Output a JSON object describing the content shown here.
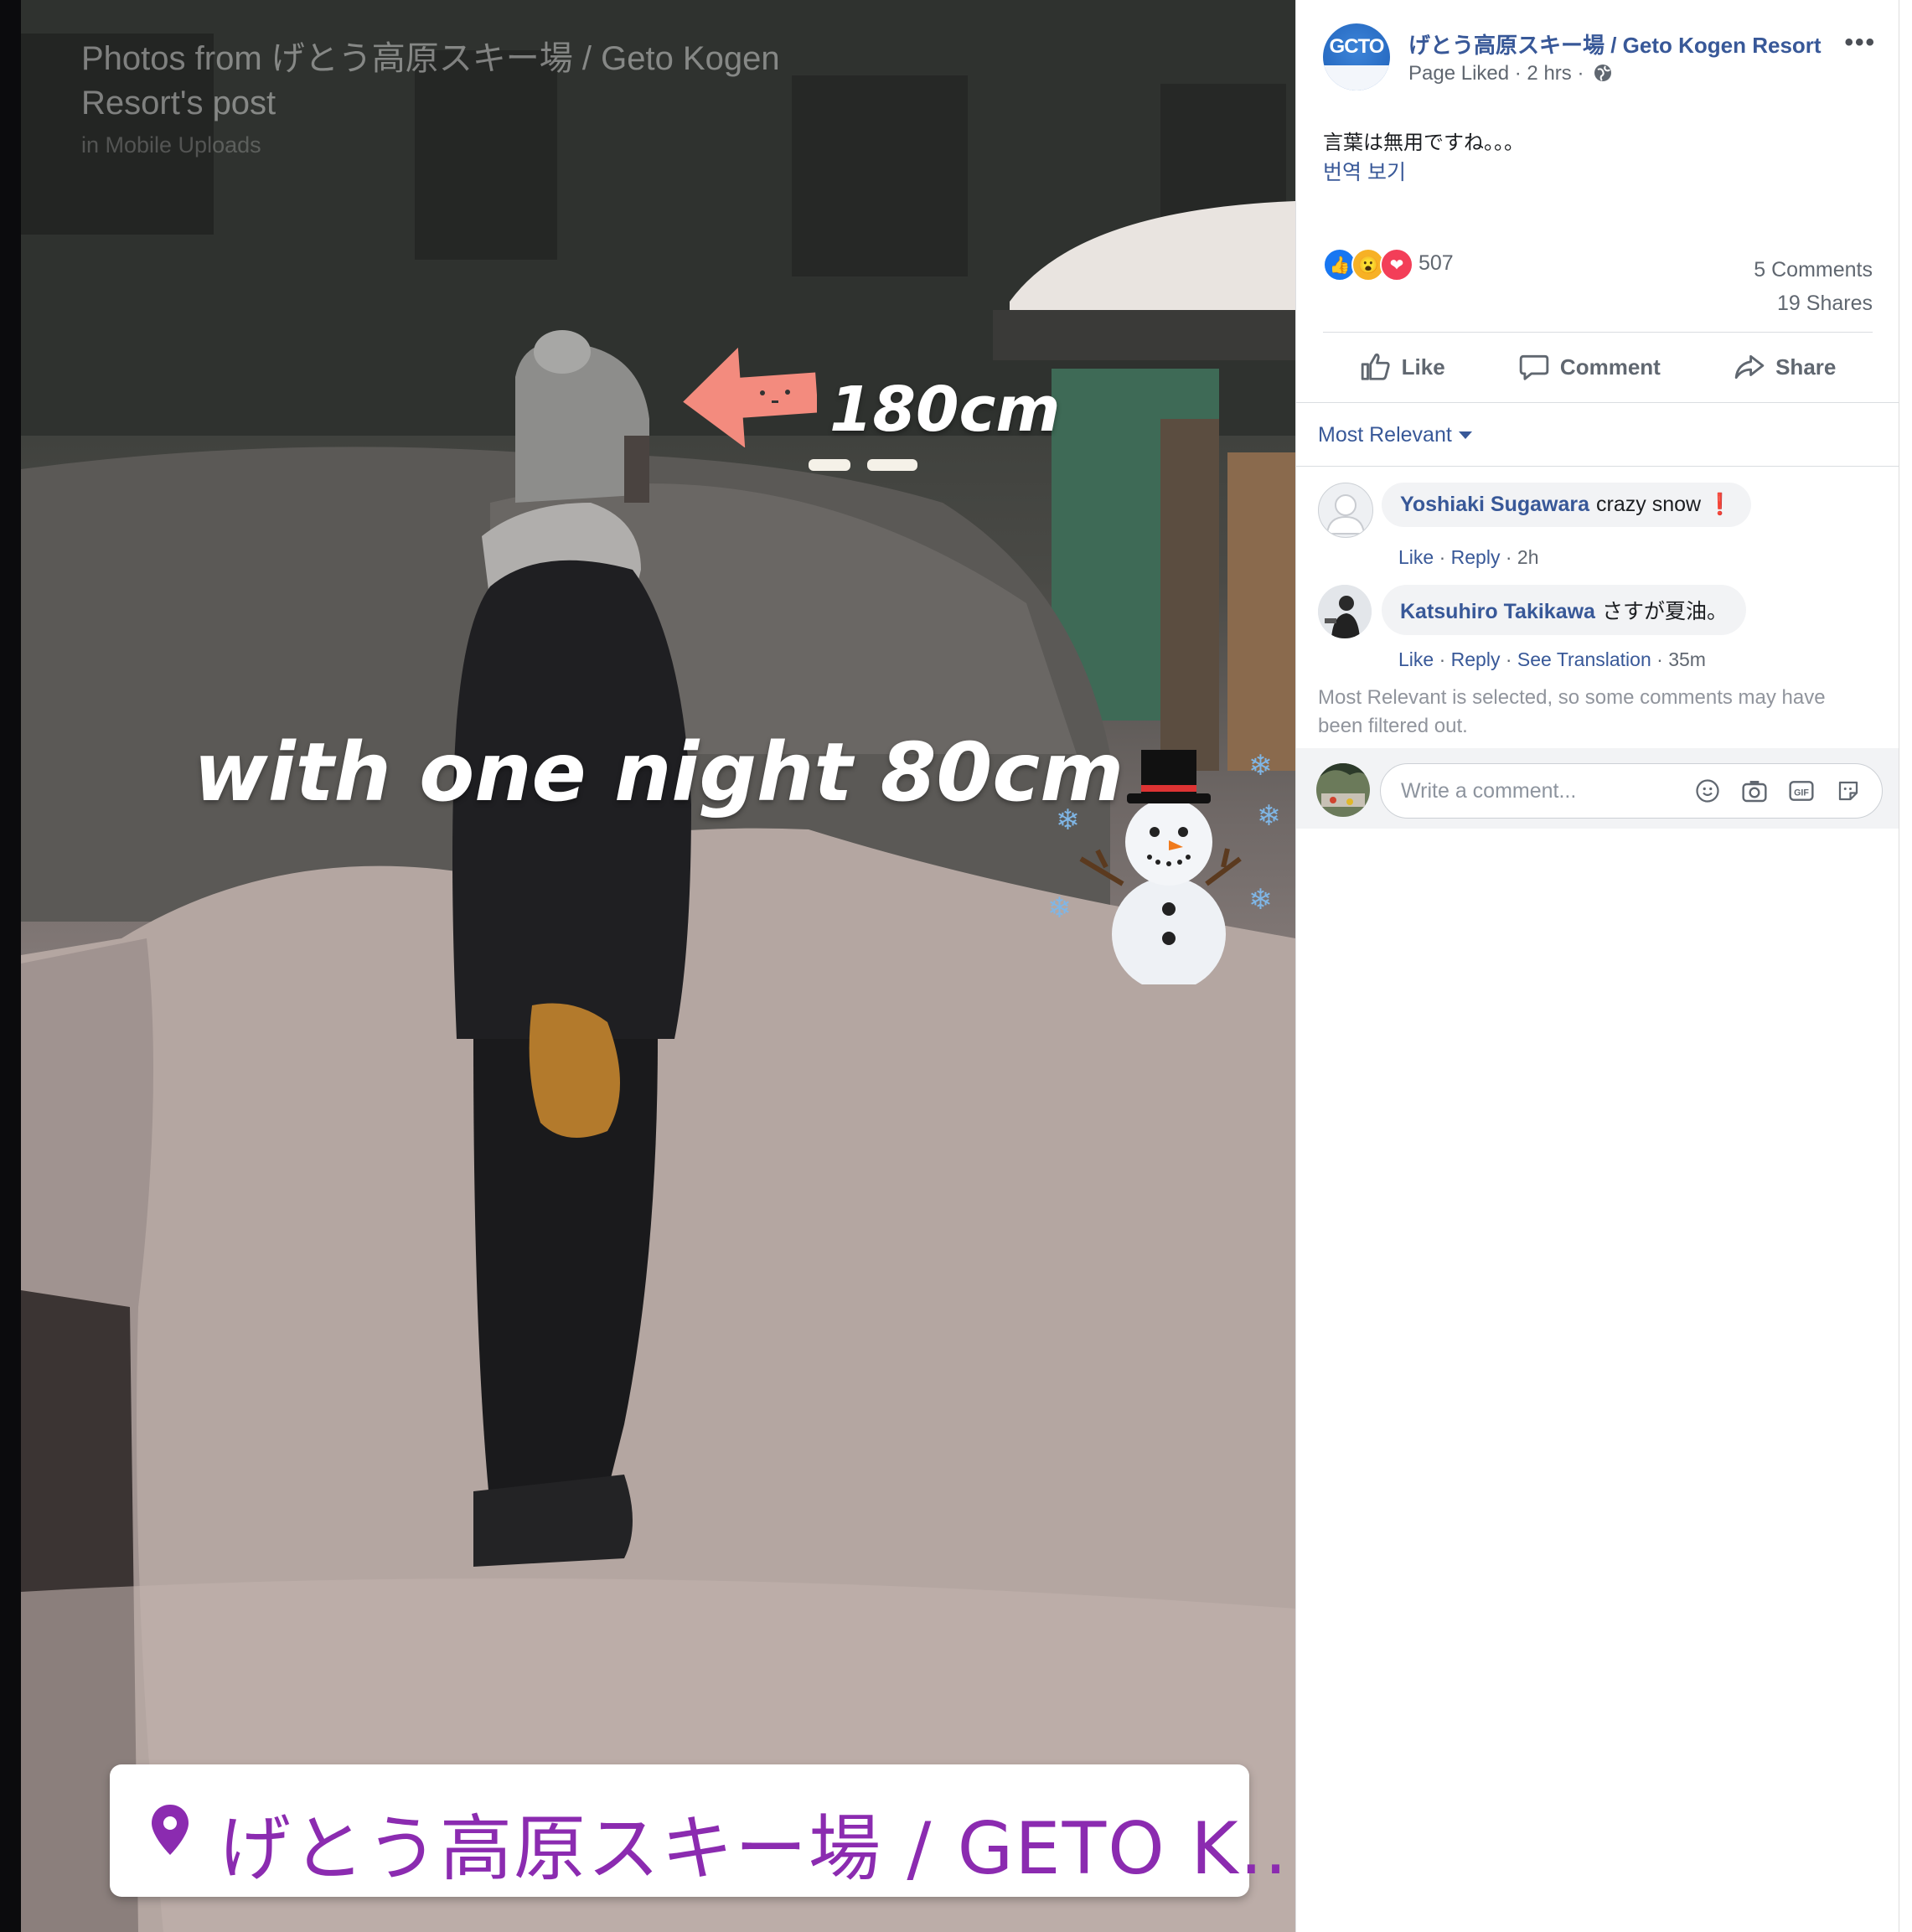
{
  "viewer": {
    "post_title": "Photos from げとう高原スキー場 / Geto Kogen Resort's post",
    "album": "in Mobile Uploads",
    "overlay_height": "180cm",
    "overlay_snowfall": "with one night 80cm",
    "location_sticker": "げとう高原スキー場 / GETO K...",
    "icons": [
      "arrow-left-icon",
      "snowman-icon",
      "location-pin-icon"
    ]
  },
  "post": {
    "page_name": "げとう高原スキー場 / Geto Kogen Resort",
    "page_logo_text": "GCTO",
    "meta": "Page Liked · 2 hrs ·",
    "more": "•••",
    "caption": "言葉は無用ですね。。。",
    "see_translation": "번역 보기",
    "reaction_count": "507",
    "comments_count": "5 Comments",
    "shares_count": "19 Shares"
  },
  "actions": {
    "like": "Like",
    "comment": "Comment",
    "share": "Share"
  },
  "comments_section": {
    "sort_label": "Most Relevant",
    "comments": [
      {
        "author": "Yoshiaki Sugawara",
        "text": "crazy snow ❗",
        "like": "Like",
        "reply": "Reply",
        "time": "2h"
      },
      {
        "author": "Katsuhiro Takikawa",
        "text": "さすが夏油。",
        "like": "Like",
        "reply": "Reply",
        "see_translation": "See Translation",
        "time": "35m"
      }
    ],
    "filter_note": "Most Relevant is selected, so some comments may have been filtered out.",
    "composer_placeholder": "Write a comment..."
  },
  "colors": {
    "link": "#385898",
    "text": "#1c1e21",
    "muted": "#606770",
    "sticker_purple": "#8b2bb0"
  }
}
